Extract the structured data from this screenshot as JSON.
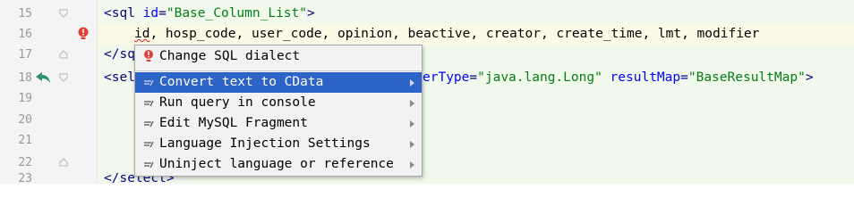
{
  "editor": {
    "lines": [
      {
        "num": "15",
        "parts": [
          [
            "tag",
            "<sql "
          ],
          [
            "attr",
            "id"
          ],
          [
            "tag",
            "="
          ],
          [
            "val",
            "\"Base_Column_List\""
          ],
          [
            "tag",
            ">"
          ]
        ]
      },
      {
        "num": "16",
        "text": "    id, hosp_code, user_code, opinion, beactive, creator, create_time, lmt, modifier"
      },
      {
        "num": "17",
        "parts": [
          [
            "tag",
            "</sq"
          ]
        ]
      },
      {
        "num": "18",
        "pre": "<sel",
        "post": "erType=\"java.lang.Long\" resultMap=\"BaseResultMap\">"
      },
      {
        "num": "19",
        "text": ""
      },
      {
        "num": "20",
        "text": ""
      },
      {
        "num": "21",
        "text": ""
      },
      {
        "num": "22",
        "text": ""
      },
      {
        "num": "23",
        "text": "</select>"
      }
    ],
    "line18_post": {
      "attr1": "erType",
      "val1": "\"java.lang.Long\"",
      "attr2": "resultMap",
      "val2": "\"BaseResultMap\"",
      "close": ">"
    },
    "line16_tokens": [
      {
        "t": "id",
        "squiggle": true
      },
      {
        "t": ", hosp_code, user_code, opinion, beactive, creator, create_time, lmt, modifier",
        "squiggle": false
      }
    ]
  },
  "context_menu": {
    "items": [
      {
        "label": "Change SQL dialect",
        "icon": "bulb-error-icon",
        "submenu": false
      },
      {
        "label": "Convert text to CData",
        "icon": "intention-icon",
        "submenu": true,
        "selected": true
      },
      {
        "label": "Run query in console",
        "icon": "intention-icon",
        "submenu": true
      },
      {
        "label": "Edit MySQL Fragment",
        "icon": "intention-icon",
        "submenu": true
      },
      {
        "label": "Language Injection Settings",
        "icon": "intention-icon",
        "submenu": true
      },
      {
        "label": "Uninject language or reference",
        "icon": "intention-icon",
        "submenu": true
      }
    ]
  },
  "colors": {
    "selection": "#2e64c8",
    "tag": "#000080",
    "attr": "#0000ff",
    "value": "#067d17",
    "error": "#e02020",
    "gutter_arrow": "#2f8f6f"
  }
}
